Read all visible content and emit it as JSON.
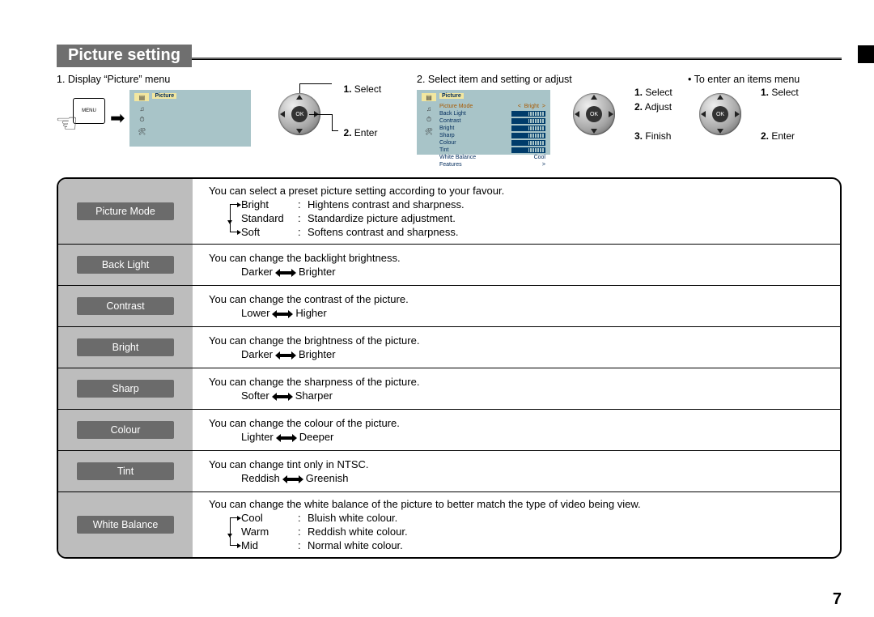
{
  "title": "Picture setting",
  "page_number": "7",
  "steps": {
    "s1": {
      "head": "1. Display “Picture” menu",
      "menu_btn": "MENU",
      "labels": {
        "l1": "1.",
        "t1": "Select",
        "l2": "2.",
        "t2": "Enter"
      }
    },
    "s2": {
      "head": "2. Select item and setting or adjust",
      "labels": {
        "l1": "1.",
        "t1": "Select",
        "l2": "2.",
        "t2": "Adjust",
        "l3": "3.",
        "t3": "Finish"
      }
    },
    "s3": {
      "head": "• To enter an items menu",
      "labels": {
        "l1": "1.",
        "t1": "Select",
        "l2": "2.",
        "t2": "Enter"
      }
    },
    "tv_title": "Picture",
    "tv_rows": {
      "r0": "Picture Mode",
      "v0l": "<",
      "v0": "Bright",
      "v0r": ">",
      "r1": "Back Light",
      "r2": "Contrast",
      "r3": "Bright",
      "r4": "Sharp",
      "r5": "Colour",
      "r6": "Tint",
      "r7": "White Balance",
      "v7": "Cool",
      "r8": "Features",
      "v8": ">"
    }
  },
  "settings": {
    "picture_mode": {
      "name": "Picture Mode",
      "text": "You can select a preset picture setting according to your favour.",
      "o1k": "Bright",
      "o1v": "Hightens contrast and sharpness.",
      "o2k": "Standard",
      "o2v": "Standardize picture adjustment.",
      "o3k": "Soft",
      "o3v": "Softens contrast and sharpness."
    },
    "back_light": {
      "name": "Back Light",
      "text": "You can change the backlight brightness.",
      "low": "Darker",
      "high": "Brighter"
    },
    "contrast": {
      "name": "Contrast",
      "text": "You can change the contrast of the picture.",
      "low": "Lower",
      "high": "Higher"
    },
    "bright": {
      "name": "Bright",
      "text": "You can change the brightness of the picture.",
      "low": "Darker",
      "high": "Brighter"
    },
    "sharp": {
      "name": "Sharp",
      "text": "You can change the sharpness of the picture.",
      "low": "Softer",
      "high": "Sharper"
    },
    "colour": {
      "name": "Colour",
      "text": "You can change the colour of the picture.",
      "low": "Lighter",
      "high": "Deeper"
    },
    "tint": {
      "name": "Tint",
      "text": "You can change tint only in NTSC.",
      "low": "Reddish",
      "high": "Greenish"
    },
    "white_balance": {
      "name": "White Balance",
      "text": "You can change the white balance of the picture to better match the type of video being view.",
      "o1k": "Cool",
      "o1v": "Bluish white colour.",
      "o2k": "Warm",
      "o2v": "Reddish white colour.",
      "o3k": "Mid",
      "o3v": "Normal white colour."
    }
  },
  "dpad_ok": "OK"
}
